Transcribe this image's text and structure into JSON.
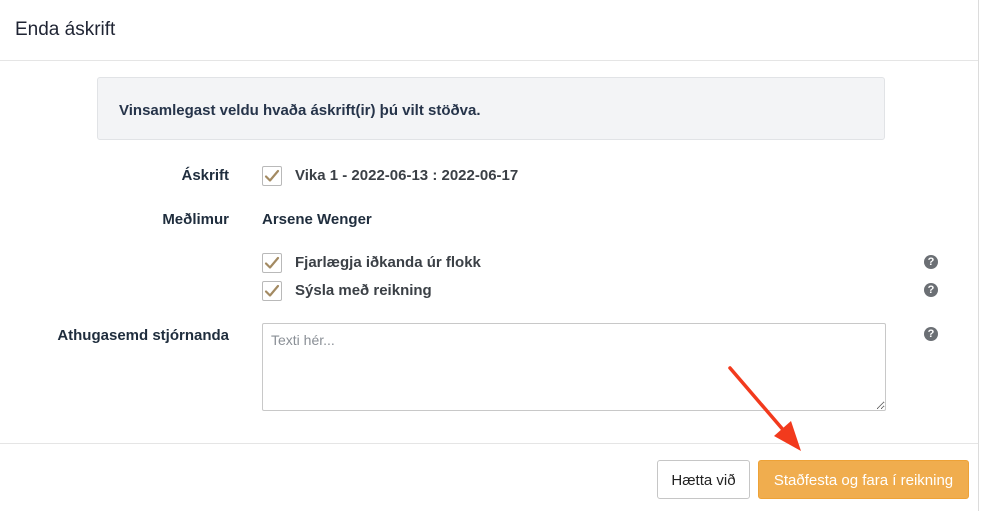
{
  "modal": {
    "title": "Enda áskrift"
  },
  "info": {
    "message": "Vinsamlegast veldu hvaða áskrift(ir) þú vilt stöðva."
  },
  "form": {
    "subscription_label": "Áskrift",
    "subscription_option": "Vika 1 - 2022-06-13 : 2022-06-17",
    "subscription_checked": true,
    "member_label": "Meðlimur",
    "member_name": "Arsene Wenger",
    "option_remove": "Fjarlægja iðkanda úr flokk",
    "option_remove_checked": true,
    "option_invoice": "Sýsla með reikning",
    "option_invoice_checked": true,
    "note_label": "Athugasemd stjórnanda",
    "note_placeholder": "Texti hér...",
    "note_value": ""
  },
  "help_icon_glyph": "?",
  "footer": {
    "cancel_label": "Hætta við",
    "confirm_label": "Staðfesta og fara í reikning"
  },
  "colors": {
    "checkmark": "#a38a62",
    "confirm_button": "#f0ad4e",
    "annotation_arrow": "#f23a1d"
  },
  "icons": {
    "help": "question-circle-icon",
    "check": "checkmark-icon",
    "annotation": "red-arrow-icon"
  }
}
